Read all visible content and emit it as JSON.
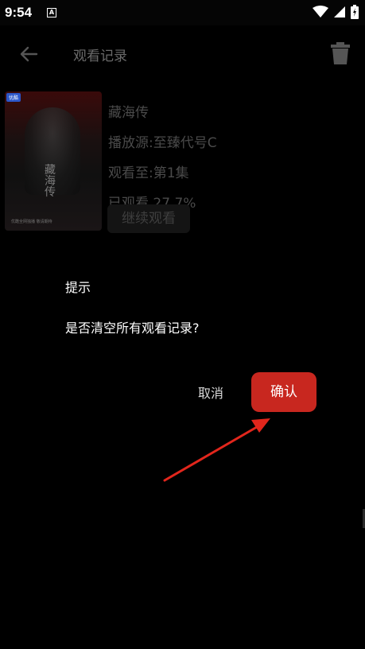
{
  "status_bar": {
    "time": "9:54",
    "notification_icon": "A",
    "icons": [
      "wifi-icon",
      "signal-icon",
      "battery-icon"
    ]
  },
  "app_bar": {
    "title": "观看记录",
    "back_icon": "arrow-left-icon",
    "delete_icon": "trash-icon"
  },
  "history_item": {
    "poster_title": "藏海传",
    "poster_badge": "优酷",
    "poster_footer": "优酷全网独播 敬请期待",
    "title": "藏海传",
    "source": "播放源:至臻代号C",
    "watched_to": "观看至:第1集",
    "progress_text": "已观看 27.7%",
    "progress": 0.277,
    "continue_label": "继续观看"
  },
  "dialog": {
    "title": "提示",
    "message": "是否清空所有观看记录?",
    "cancel_label": "取消",
    "confirm_label": "确认",
    "confirm_color": "#c8271f"
  },
  "annotation": {
    "color": "#e2261c"
  }
}
